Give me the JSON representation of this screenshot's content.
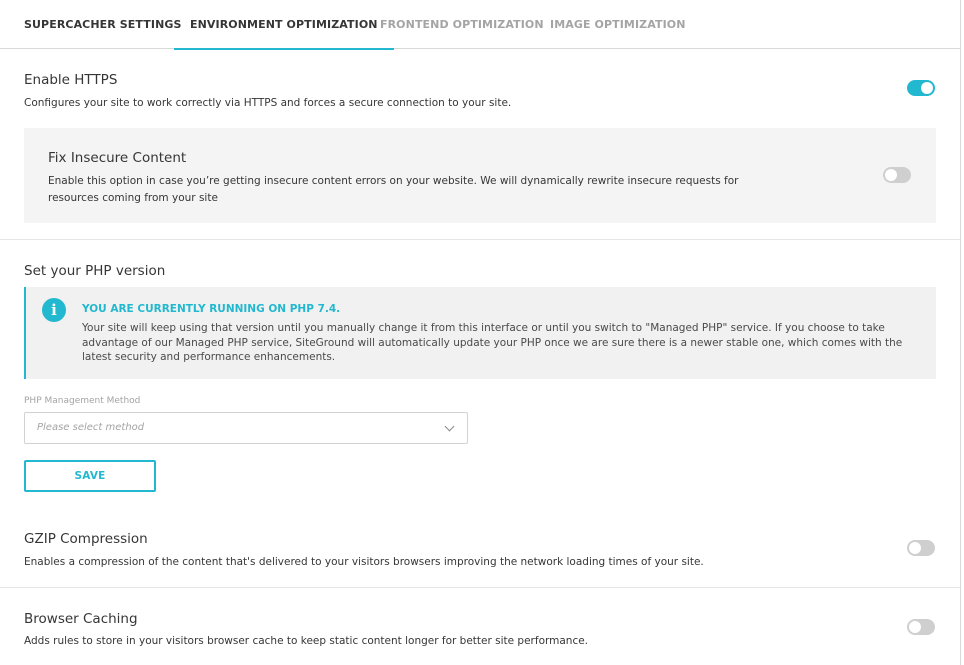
{
  "tabs": [
    {
      "label": "SUPERCACHER SETTINGS",
      "active": false
    },
    {
      "label": "ENVIRONMENT OPTIMIZATION",
      "active": true
    },
    {
      "label": "FRONTEND OPTIMIZATION",
      "active": false
    },
    {
      "label": "IMAGE OPTIMIZATION",
      "active": false
    }
  ],
  "https": {
    "title": "Enable HTTPS",
    "description": "Configures your site to work correctly via HTTPS and forces a secure connection to your site.",
    "enabled": true
  },
  "insecure": {
    "title": "Fix Insecure Content",
    "description": "Enable this option in case you’re getting insecure content errors on your website. We will dynamically rewrite insecure requests for resources coming from your site",
    "enabled": false
  },
  "php": {
    "title": "Set your PHP version",
    "notice_icon": "info-icon",
    "notice_title": "YOU ARE CURRENTLY RUNNING ON PHP 7.4.",
    "notice_text": "Your site will keep using that version until you manually change it from this interface or until you switch to \"Managed PHP\" service. If you choose to take advantage of our Managed PHP service, SiteGround will automatically update your PHP once we are sure there is a newer stable one, which comes with the latest security and performance enhancements.",
    "field_label": "PHP Management Method",
    "select_placeholder": "Please select method",
    "save_label": "SAVE"
  },
  "gzip": {
    "title": "GZIP Compression",
    "description": "Enables a compression of the content that's delivered to your visitors browsers improving the network loading times of your site.",
    "enabled": false
  },
  "caching": {
    "title": "Browser Caching",
    "description": "Adds rules to store in your visitors browser cache to keep static content longer for better site performance.",
    "enabled": false
  },
  "colors": {
    "accent": "#22b8cf",
    "toggle_off": "#cfcfcf",
    "panel_bg": "#f4f4f4"
  }
}
